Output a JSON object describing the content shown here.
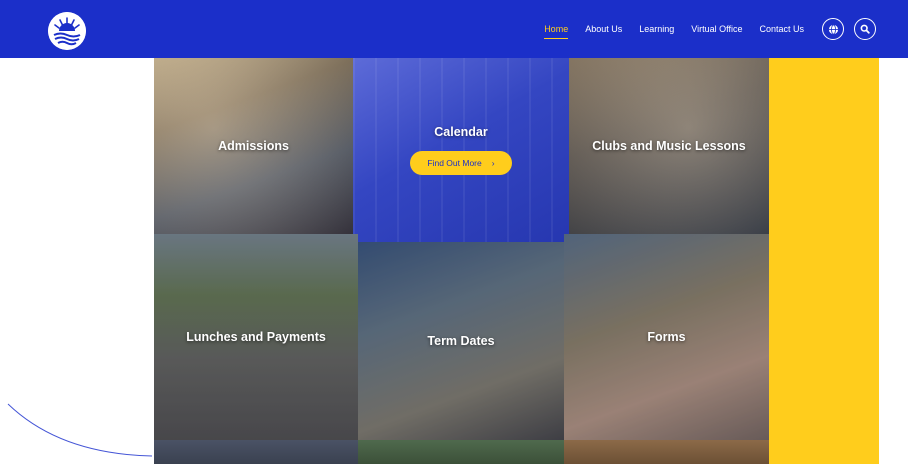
{
  "header": {
    "logo_alt": "School logo",
    "nav": [
      {
        "label": "Home",
        "active": true
      },
      {
        "label": "About Us",
        "active": false
      },
      {
        "label": "Learning",
        "active": false
      },
      {
        "label": "Virtual Office",
        "active": false
      },
      {
        "label": "Contact Us",
        "active": false
      }
    ],
    "translate_icon": "globe-icon",
    "search_icon": "search-icon"
  },
  "tiles": [
    {
      "label": "Admissions",
      "cta": ""
    },
    {
      "label": "Calendar",
      "cta": "Find Out More"
    },
    {
      "label": "Clubs and Music Lessons",
      "cta": ""
    },
    {
      "label": "Lunches and Payments",
      "cta": ""
    },
    {
      "label": "Term Dates",
      "cta": ""
    },
    {
      "label": "Forms",
      "cta": ""
    }
  ],
  "colors": {
    "brand_blue": "#1b2fc9",
    "accent_yellow": "#ffcd1c",
    "white": "#ffffff"
  }
}
